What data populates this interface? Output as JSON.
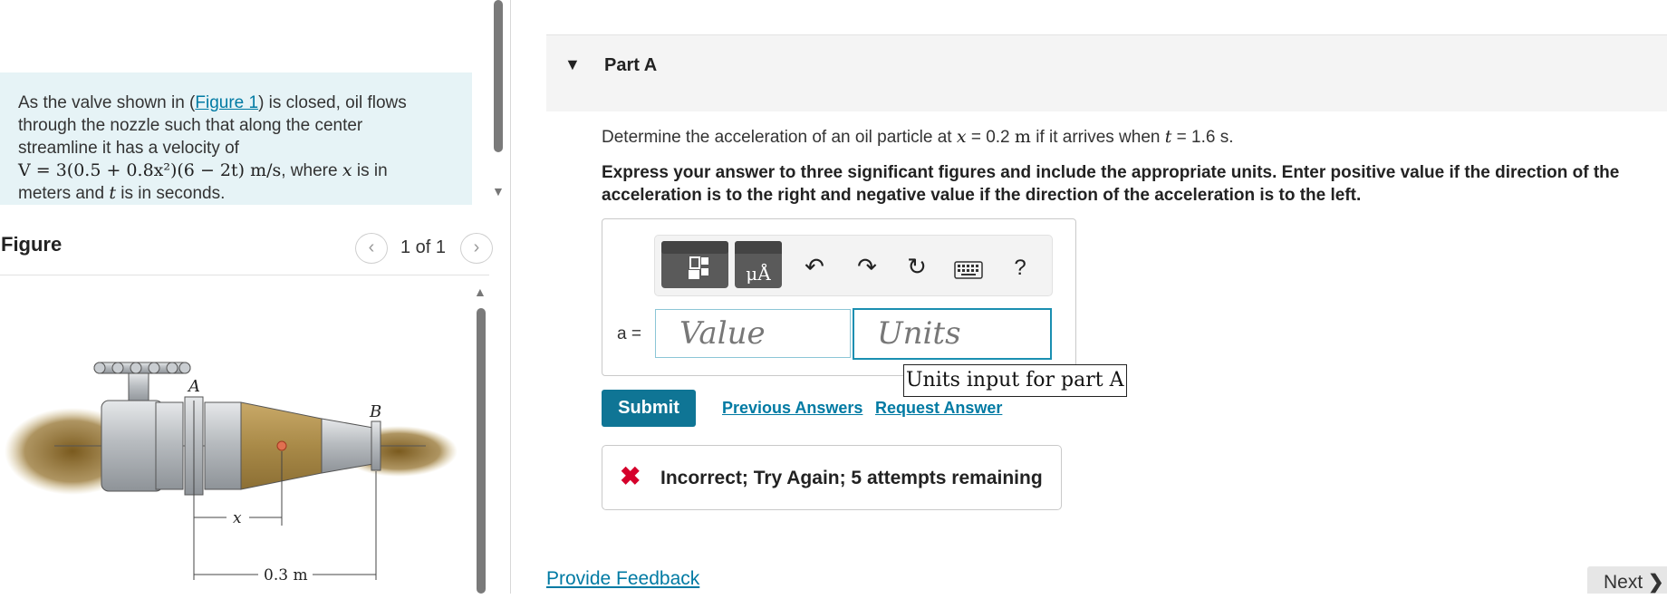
{
  "problem": {
    "p1": "As the valve shown in (",
    "figure_link": "Figure 1",
    "p2": ") is closed, oil flows through the nozzle such that along the center streamline it has a velocity of",
    "formula": "V = 3(0.5 + 0.8x²)(6 − 2t) m/s",
    "p3": ", where ",
    "x_var": "x",
    "p4": " is in meters and ",
    "t_var": "t",
    "p5": " is in seconds."
  },
  "figure": {
    "title": "Figure",
    "pager_text": "1 of 1",
    "label_a": "A",
    "label_b": "B",
    "label_x": "x",
    "label_dist": "0.3 m"
  },
  "part": {
    "title": "Part A",
    "question_a": "Determine the acceleration of an oil particle at ",
    "x_eq": "x",
    "eq1": " = 0.2 ",
    "unit_m": "m",
    "question_b": " if it arrives when ",
    "t_eq": "t",
    "eq2": " = 1.6 s.",
    "instructions": "Express your answer to three significant figures and include the appropriate units. Enter positive value if the direction of the acceleration is to the right and negative value if the direction of the acceleration is to the left."
  },
  "answer": {
    "var_label": "a =",
    "value_placeholder": "Value",
    "units_placeholder": "Units",
    "tooltip": "Units input for part A",
    "units_tool_label": "μÅ",
    "help_label": "?"
  },
  "actions": {
    "submit": "Submit",
    "previous": "Previous Answers",
    "request": "Request Answer"
  },
  "feedback": {
    "icon": "✖",
    "text": "Incorrect; Try Again; 5 attempts remaining"
  },
  "footer": {
    "provide_feedback": "Provide Feedback",
    "next": "Next"
  },
  "colors": {
    "accent": "#0f7595",
    "link": "#007aa3",
    "problem_bg": "#e6f3f6",
    "error": "#d5002b"
  }
}
